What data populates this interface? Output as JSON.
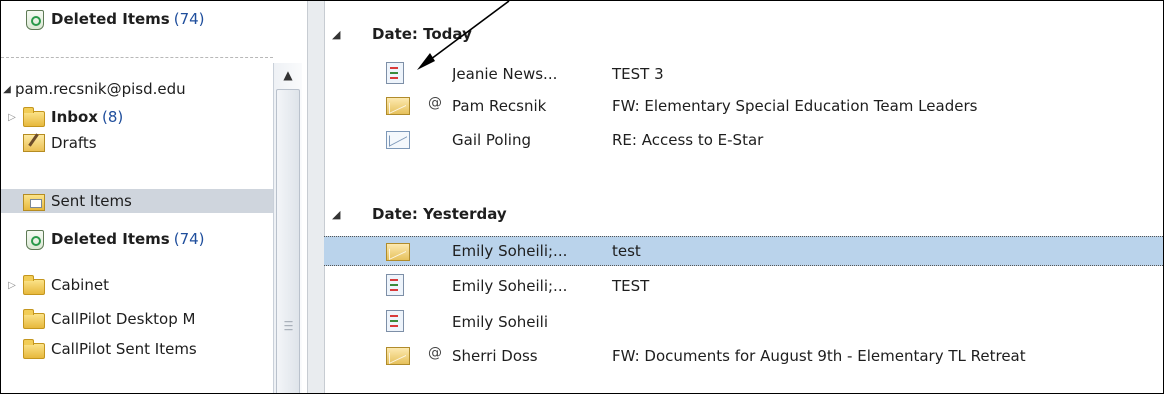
{
  "nav": {
    "deleted_top": {
      "label": "Deleted Items",
      "count": "(74)"
    },
    "account": "pam.recsnik@pisd.edu",
    "folders": [
      {
        "label": "Inbox",
        "count": "(8)"
      },
      {
        "label": "Drafts"
      },
      {
        "label": "Sent Items"
      },
      {
        "label": "Deleted Items",
        "count": "(74)"
      },
      {
        "label": "Cabinet"
      },
      {
        "label": "CallPilot Desktop M"
      },
      {
        "label": "CallPilot Sent Items"
      }
    ]
  },
  "list": {
    "groups": [
      {
        "label": "Date: Today",
        "messages": [
          {
            "from": "Jeanie News...",
            "subject": "TEST 3"
          },
          {
            "from": "Pam Recsnik",
            "subject": "FW: Elementary Special Education Team Leaders",
            "attachment": "@"
          },
          {
            "from": "Gail Poling",
            "subject": "RE: Access to E-Star"
          }
        ]
      },
      {
        "label": "Date: Yesterday",
        "messages": [
          {
            "from": "Emily Soheili;...",
            "subject": "test"
          },
          {
            "from": "Emily Soheili;...",
            "subject": "TEST"
          },
          {
            "from": "Emily Soheili",
            "subject": ""
          },
          {
            "from": "Sherri Doss",
            "subject": "FW: Documents for August 9th - Elementary TL Retreat",
            "attachment": "@"
          }
        ]
      }
    ]
  },
  "colors": {
    "selection": "#bad3eb",
    "count": "#1f4e9c",
    "nav_selected": "#cfd5dd"
  }
}
